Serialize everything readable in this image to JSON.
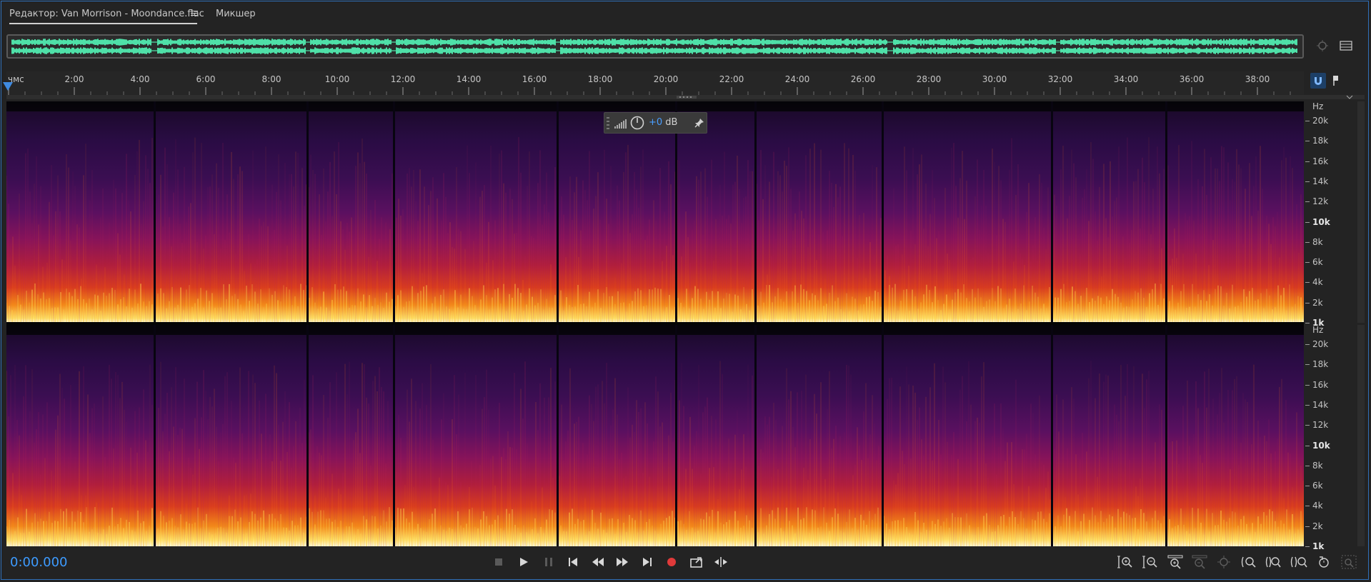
{
  "tabs": {
    "editor_label": "Редактор: Van Morrison - Moondance.flac",
    "mixer_label": "Микшер"
  },
  "ruler": {
    "unit_label": "чмс",
    "ticks": [
      "2:00",
      "4:00",
      "6:00",
      "8:00",
      "10:00",
      "12:00",
      "14:00",
      "16:00",
      "18:00",
      "20:00",
      "22:00",
      "24:00",
      "26:00",
      "28:00",
      "30:00",
      "32:00",
      "34:00",
      "36:00",
      "38:00"
    ]
  },
  "freq_axis": {
    "unit": "Hz",
    "labels": [
      "20k",
      "18k",
      "16k",
      "14k",
      "12k",
      "10k",
      "8k",
      "6k",
      "4k",
      "2k",
      "1k"
    ],
    "channel2_labels": [
      "20k",
      "18k",
      "16k",
      "14k",
      "12k",
      "10k",
      "8k",
      "6k",
      "4k",
      "2k",
      "1k"
    ]
  },
  "gain_hud": {
    "value": "+0",
    "unit": " dB"
  },
  "transport": {
    "time": "0:00.000"
  },
  "icons": {
    "accent": "#3d9bff",
    "record": "#e03a3a",
    "waveform": "#4fe0a8"
  }
}
